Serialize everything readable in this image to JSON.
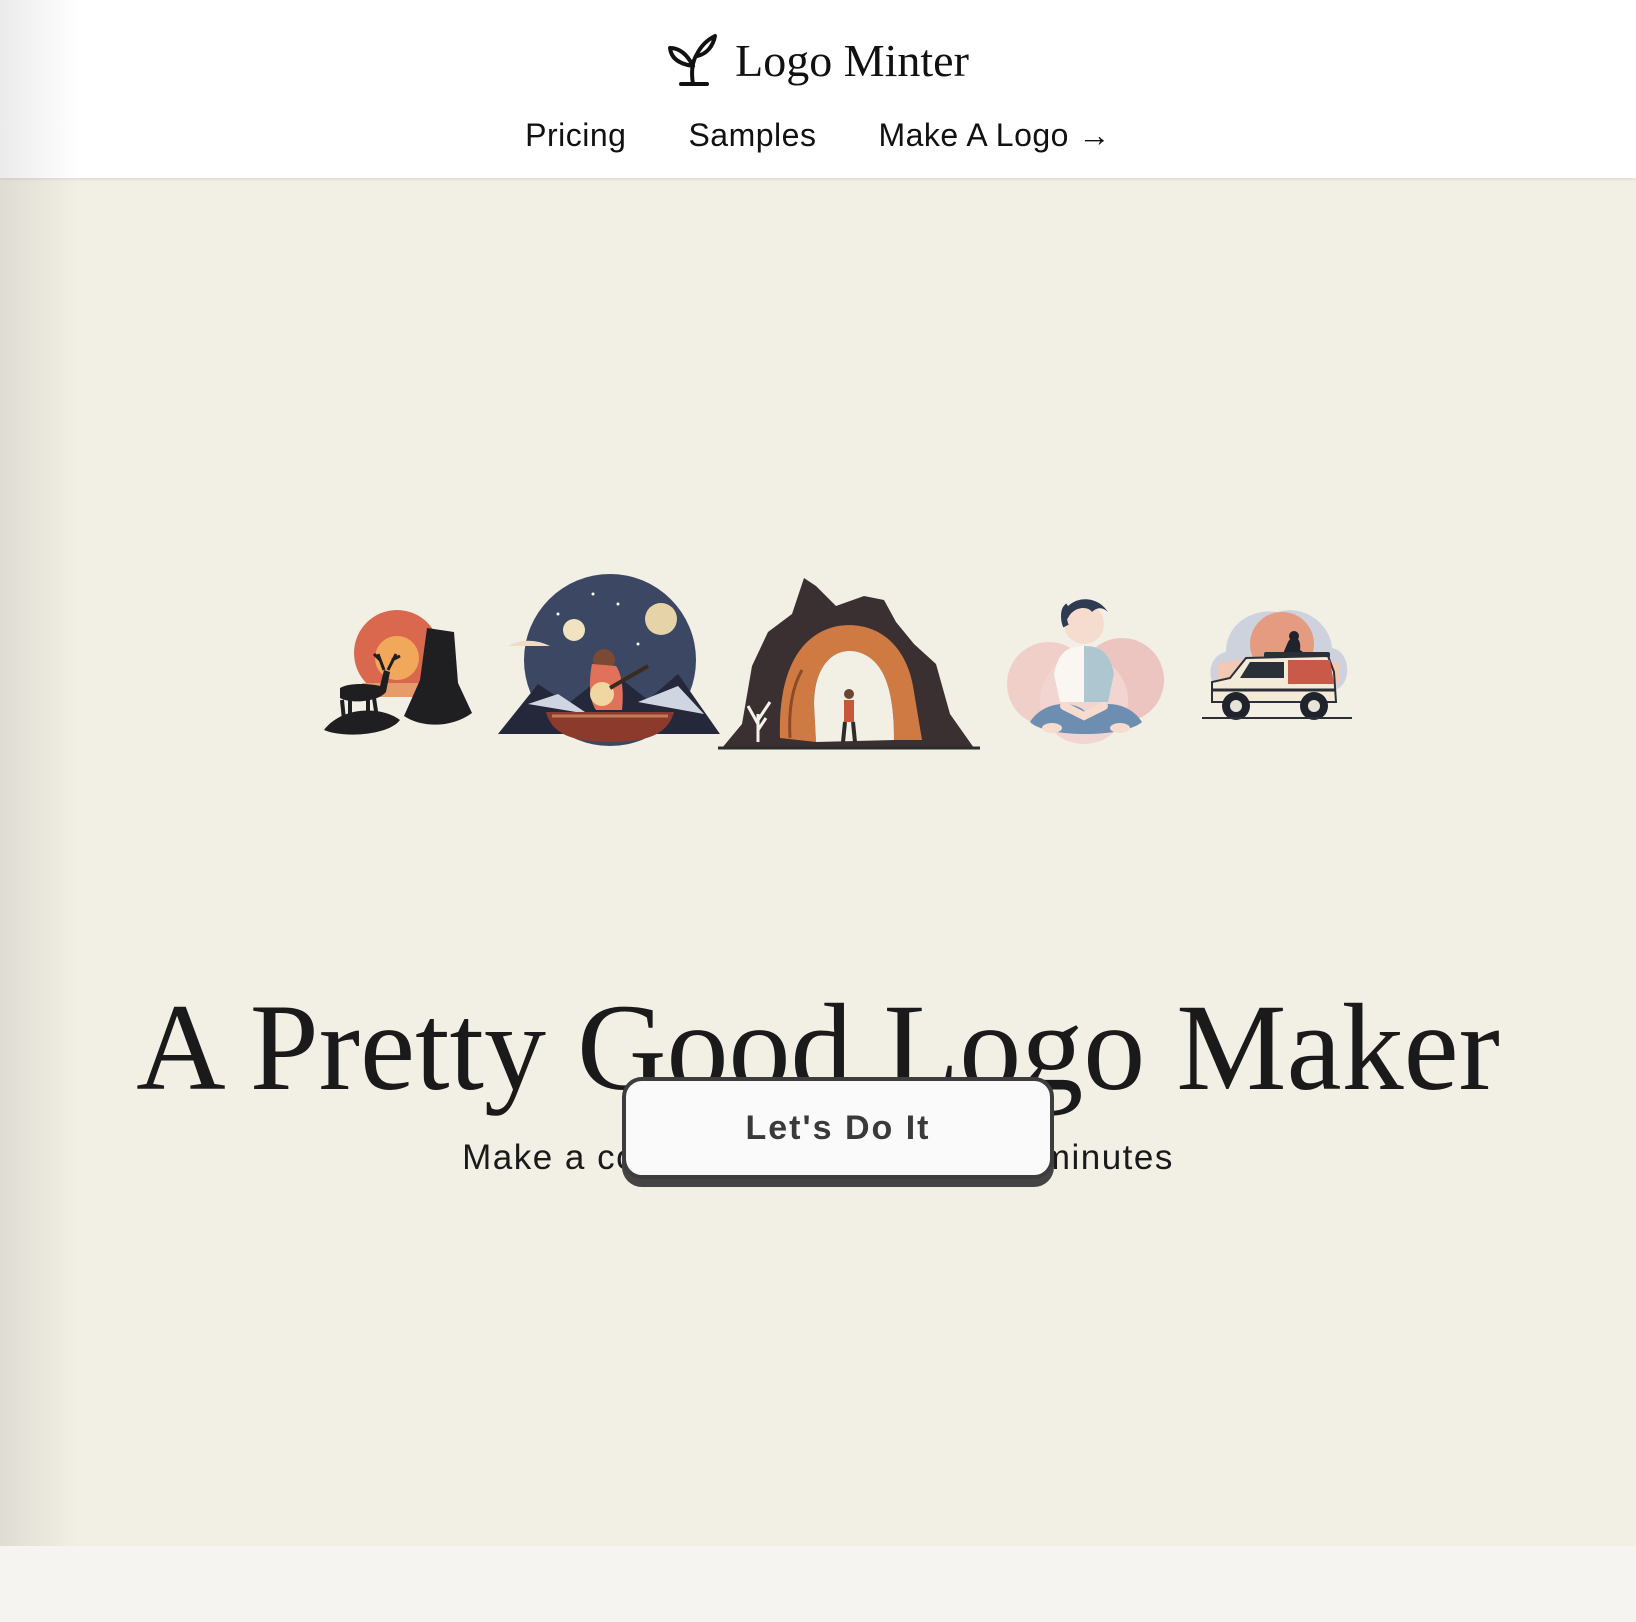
{
  "header": {
    "brand_name": "Logo Minter",
    "brand_icon": "sprout-icon",
    "nav": [
      {
        "label": "Pricing"
      },
      {
        "label": "Samples"
      },
      {
        "label": "Make A Logo →"
      }
    ]
  },
  "hero": {
    "illustrations": [
      {
        "name": "deer-sunset-illustration"
      },
      {
        "name": "canoe-guitar-illustration"
      },
      {
        "name": "rock-arch-illustration"
      },
      {
        "name": "meditating-woman-illustration"
      },
      {
        "name": "vintage-car-illustration"
      }
    ],
    "title": "A Pretty Good Logo Maker",
    "subtitle": "Make a completely unique logo in minutes",
    "cta_label": "Let's Do It"
  },
  "colors": {
    "hero_background": "#f2efe5",
    "header_background": "#ffffff",
    "text": "#1a1a1a",
    "button_border": "#3d3d3d"
  }
}
